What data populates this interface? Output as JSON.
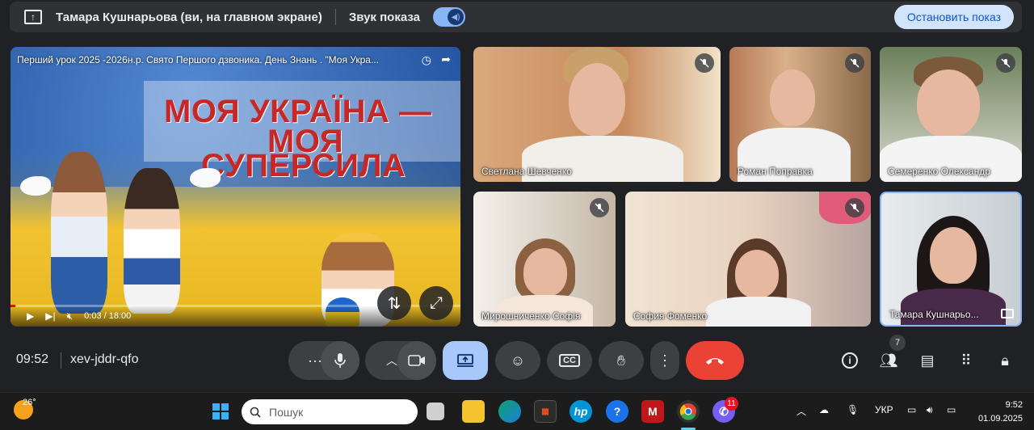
{
  "presenting_bar": {
    "presenter": "Тамара Кушнарьова (ви, на главном экране)",
    "sound_label": "Звук показа",
    "stop_button": "Остановить показ"
  },
  "presentation": {
    "video_title": "Перший урок 2025 -2026н.р. Свято Першого дзвоника. День Знань . \"Моя Укра...",
    "poster_line1": "МОЯ УКРАЇНА —",
    "poster_line2": "МОЯ",
    "poster_line3": "СУПЕРСИЛА",
    "time_display": "0:03 / 18:00",
    "progress": 0.003
  },
  "participants": [
    {
      "name": "Светлана Шевченко",
      "muted": true
    },
    {
      "name": "Роман Поправка",
      "muted": true
    },
    {
      "name": "Семеренко Олександр",
      "muted": true
    },
    {
      "name": "Мирошниченко Софія",
      "muted": true
    },
    {
      "name": "София Фоменко",
      "muted": true
    },
    {
      "name": "Тамара Кушнарьо...",
      "muted": false
    }
  ],
  "controls": {
    "time": "09:52",
    "meeting_code": "xev-jddr-qfo",
    "people_count": "7"
  },
  "taskbar": {
    "temperature": "26°",
    "search_placeholder": "Пошук",
    "viber_badge": "11",
    "language": "УКР",
    "clock_time": "9:52",
    "clock_date": "01.09.2025"
  },
  "colors": {
    "background": "#202124",
    "accent": "#a8c7fa",
    "end_call": "#ea4335"
  }
}
